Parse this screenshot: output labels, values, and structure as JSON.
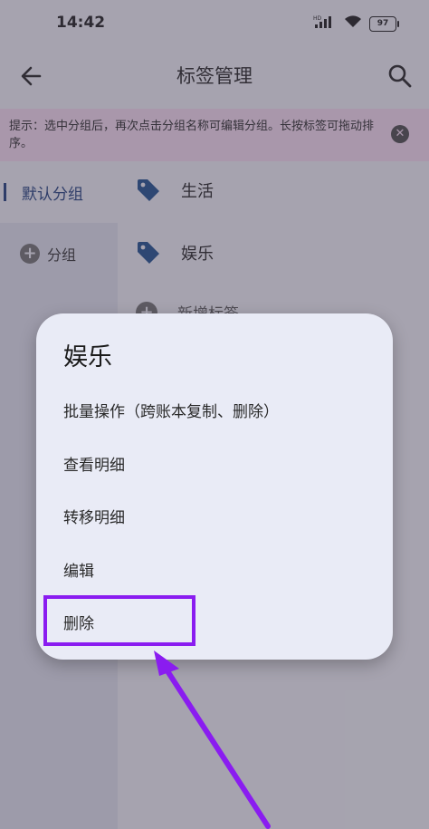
{
  "status_bar": {
    "time": "14:42",
    "battery": "97",
    "icons": [
      "hd-signal-icon",
      "wifi-icon",
      "battery-icon"
    ]
  },
  "app_bar": {
    "title": "标签管理",
    "back_icon": "back-arrow-icon",
    "search_icon": "search-icon"
  },
  "tip": {
    "text": "提示：选中分组后，再次点击分组名称可编辑分组。长按标签可拖动排序。",
    "close_icon": "close-circle-icon"
  },
  "sidebar": {
    "selected_group": "默认分组",
    "add_group_label": "分组"
  },
  "tags": [
    {
      "label": "生活",
      "icon": "tag-icon"
    },
    {
      "label": "娱乐",
      "icon": "tag-icon"
    }
  ],
  "add_tag_label": "新增标签",
  "dialog": {
    "title": "娱乐",
    "items": [
      {
        "label": "批量操作（跨账本复制、删除）"
      },
      {
        "label": "查看明细"
      },
      {
        "label": "转移明细"
      },
      {
        "label": "编辑"
      },
      {
        "label": "删除"
      }
    ]
  },
  "colors": {
    "accent": "#1f3d7a",
    "tag_icon": "#1e4f8c",
    "tip_background": "#f2d8ec",
    "annotation": "#8a1cf0",
    "dialog_background": "#e9ebf6"
  }
}
